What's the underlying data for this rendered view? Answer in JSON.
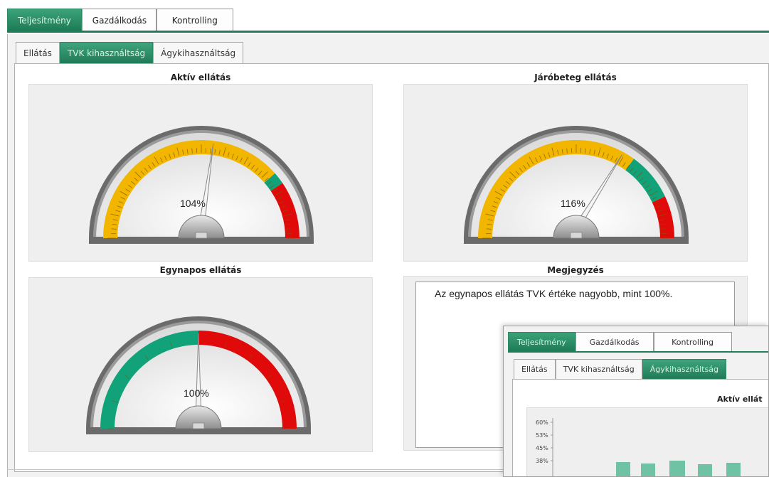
{
  "top_tabs": [
    "Teljesítmény",
    "Gazdálkodás",
    "Kontrolling"
  ],
  "sub_tabs": [
    "Ellátás",
    "TVK kihasználtság",
    "Ágykihasználtság"
  ],
  "gauges": [
    {
      "title": "Aktív ellátás",
      "value_label": "104%",
      "value": 104
    },
    {
      "title": "Járóbeteg ellátás",
      "value_label": "116%",
      "value": 116
    },
    {
      "title": "Egynapos ellátás",
      "value_label": "100%",
      "value": 100
    }
  ],
  "note": {
    "title": "Megjegyzés",
    "text": "Az egynapos ellátás TVK értéke nagyobb, mint 100%."
  },
  "overlay": {
    "top_tabs": [
      "Teljesítmény",
      "Gazdálkodás",
      "Kontrolling"
    ],
    "sub_tabs": [
      "Ellátás",
      "TVK kihasználtság",
      "Ágykihasználtság"
    ],
    "chart_title": "Aktív ellát",
    "y_ticks": [
      "60%",
      "53%",
      "45%",
      "38%"
    ]
  },
  "colors": {
    "accent": "#1f7d58",
    "gauge_yellow": "#f2b600",
    "gauge_green": "#11a27a",
    "gauge_red": "#e00a0a"
  }
}
